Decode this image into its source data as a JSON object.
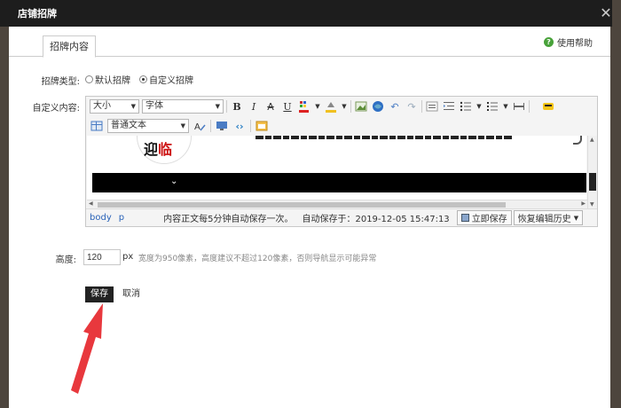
{
  "dialog": {
    "title": "店铺招牌",
    "close_icon": "close-icon"
  },
  "tabs": [
    {
      "label": "招牌内容",
      "active": true
    }
  ],
  "help": {
    "label": "使用帮助",
    "icon": "help-icon",
    "icon_glyph": "?"
  },
  "sign_type": {
    "label": "招牌类型:",
    "options": [
      {
        "label": "默认招牌",
        "checked": false
      },
      {
        "label": "自定义招牌",
        "checked": true
      }
    ]
  },
  "custom_content": {
    "label": "自定义内容:"
  },
  "editor": {
    "size_select": "大小",
    "font_select": "字体",
    "format_select": "普通文本",
    "toolbar_glyphs": {
      "bold": "B",
      "italic": "I",
      "strike": "A",
      "underline": "U"
    },
    "banner_logo": {
      "char1": "迎",
      "char2": "临"
    },
    "path": [
      "body",
      "p"
    ],
    "autosave_note": "内容正文每5分钟自动保存一次。",
    "autosave_time": "自动保存于：2019-12-05 15:47:13",
    "save_now": "立即保存",
    "restore_history": "恢复编辑历史"
  },
  "height": {
    "label": "高度:",
    "value": "120",
    "unit": "px",
    "hint": "宽度为950像素，高度建议不超过120像素，否则导航显示可能异常"
  },
  "actions": {
    "save": "保存",
    "cancel": "取消"
  },
  "colors": {
    "titlebar": "#1d1d1d",
    "backdrop": "#5a5046",
    "save_button": "#222222",
    "arrow": "#e8383d",
    "help_green": "#48a23a",
    "link_blue": "#2a63b8"
  }
}
